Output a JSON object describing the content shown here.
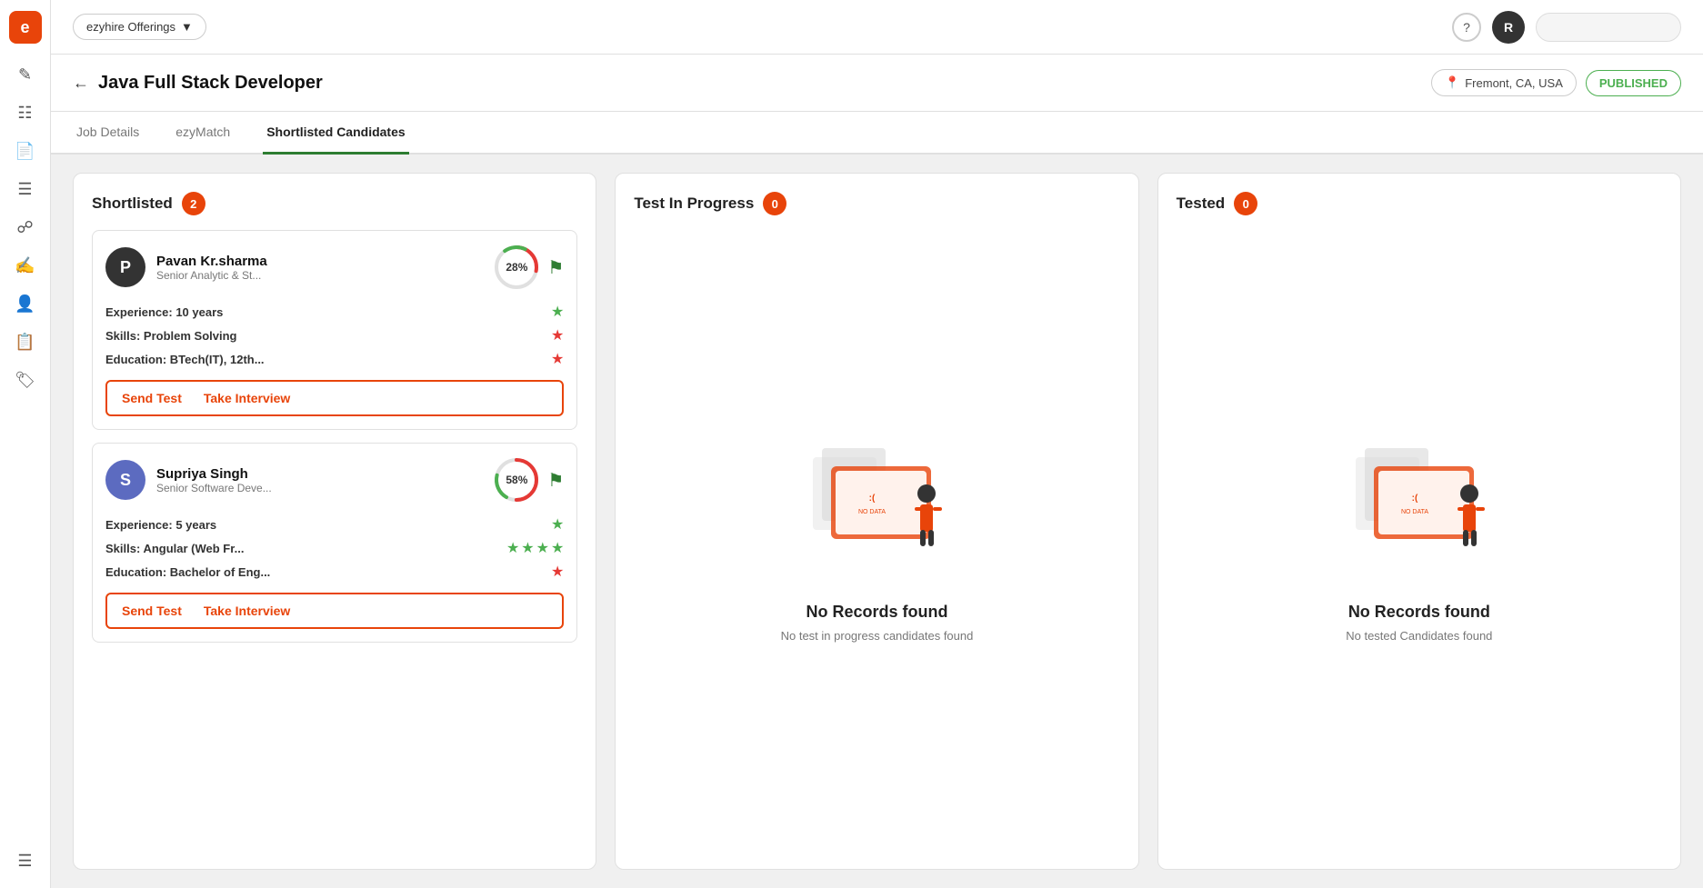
{
  "app": {
    "logo": "e",
    "offerings_label": "ezyhire Offerings",
    "help_icon": "?",
    "user_initial": "R"
  },
  "page_header": {
    "back_label": "←",
    "title": "Java Full Stack Developer",
    "location": "Fremont, CA, USA",
    "status": "PUBLISHED"
  },
  "tabs": [
    {
      "id": "job-details",
      "label": "Job Details",
      "active": false
    },
    {
      "id": "ezymatch",
      "label": "ezyMatch",
      "active": false
    },
    {
      "id": "shortlisted-candidates",
      "label": "Shortlisted Candidates",
      "active": true
    }
  ],
  "columns": [
    {
      "id": "shortlisted",
      "title": "Shortlisted",
      "count": 2,
      "candidates": [
        {
          "id": "pavan",
          "initial": "P",
          "name": "Pavan Kr.sharma",
          "role": "Senior Analytic & St...",
          "score_pct": 28,
          "score_label": "28%",
          "experience": "10 years",
          "experience_stars": [
            "green"
          ],
          "skills": "Problem Solving",
          "skills_stars": [
            "red"
          ],
          "education": "BTech(IT), 12th...",
          "education_stars": [
            "red"
          ],
          "actions": [
            "Send Test",
            "Take Interview"
          ]
        },
        {
          "id": "supriya",
          "initial": "S",
          "name": "Supriya Singh",
          "role": "Senior Software Deve...",
          "score_pct": 58,
          "score_label": "58%",
          "experience": "5 years",
          "experience_stars": [
            "green"
          ],
          "skills": "Angular (Web Fr...",
          "skills_stars": [
            "green",
            "green",
            "green",
            "green"
          ],
          "education": "Bachelor of Eng...",
          "education_stars": [
            "red"
          ],
          "actions": [
            "Send Test",
            "Take Interview"
          ]
        }
      ]
    },
    {
      "id": "test-in-progress",
      "title": "Test In Progress",
      "count": 0,
      "empty": true,
      "empty_title": "No Records found",
      "empty_desc": "No test in progress candidates found"
    },
    {
      "id": "tested",
      "title": "Tested",
      "count": 0,
      "empty": true,
      "empty_title": "No Records found",
      "empty_desc": "No tested Candidates found"
    }
  ],
  "sidebar_icons": [
    "person",
    "grid",
    "briefcase",
    "layers",
    "list",
    "chat",
    "users",
    "document",
    "tag",
    "table"
  ],
  "detail_labels": {
    "experience": "Experience: ",
    "skills": "Skills: ",
    "education": "Education: "
  }
}
